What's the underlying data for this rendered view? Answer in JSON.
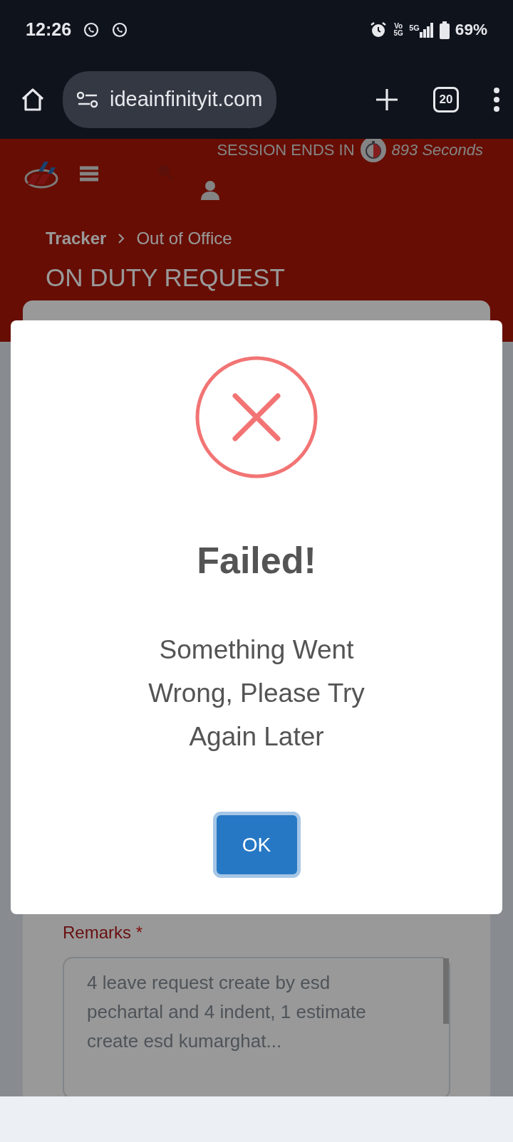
{
  "status_bar": {
    "time": "12:26",
    "volte": "Vo 5G",
    "network": "5G",
    "battery": "69%"
  },
  "browser": {
    "url": "ideainfinityit.com",
    "tab_count": "20"
  },
  "header": {
    "session_label": "SESSION ENDS IN",
    "session_value": "893 Seconds",
    "breadcrumb": [
      "Tracker",
      "Out of Office"
    ],
    "page_title": "ON DUTY REQUEST"
  },
  "form": {
    "remarks_label": "Remarks",
    "required_mark": "*",
    "remarks_value": "4 leave request create by esd pechartal and 4 indent, 1 estimate create esd kumarghat..."
  },
  "dialog": {
    "kind": "error",
    "title": "Failed!",
    "message": "Something Went Wrong, Please Try Again Later",
    "button": "OK",
    "button_focused": true
  }
}
